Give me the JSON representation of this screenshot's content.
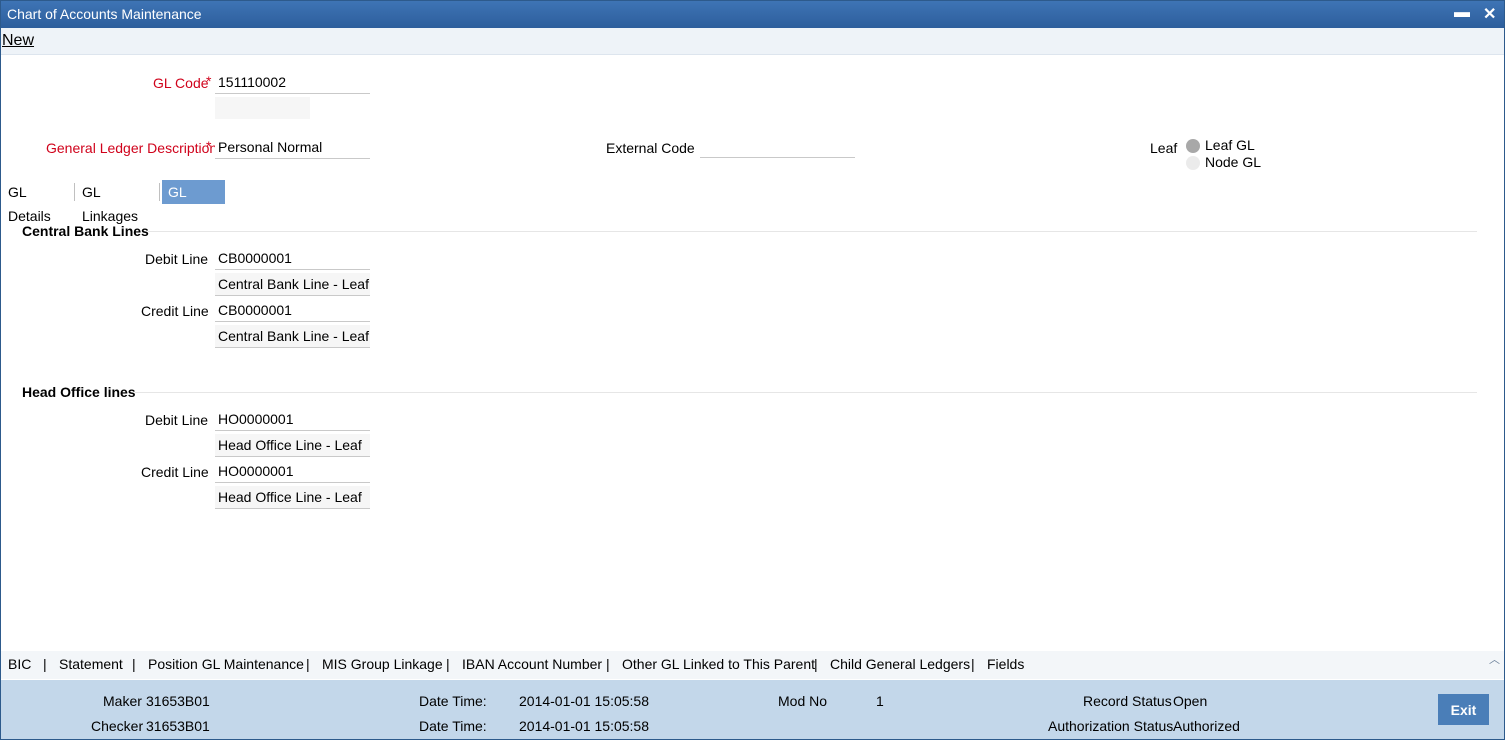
{
  "window": {
    "title": "Chart of Accounts Maintenance",
    "minimize_glyph": "▬",
    "close_glyph": "✕"
  },
  "menu": {
    "new_label": "New"
  },
  "header": {
    "gl_code_label": "GL Code",
    "gl_code_value": "151110002",
    "required_mark": "*",
    "gl_desc_label": "General Ledger Description",
    "gl_desc_value": "Personal Normal",
    "external_code_label": "External Code",
    "external_code_value": "",
    "leaf_label": "Leaf",
    "leaf_options": [
      "Leaf GL",
      "Node GL"
    ],
    "leaf_selected": "Leaf GL"
  },
  "tabs": [
    {
      "label": "GL Details",
      "active": false
    },
    {
      "label": "GL Linkages",
      "active": false
    },
    {
      "label": "GL Lines",
      "active": true
    }
  ],
  "central_bank": {
    "title": "Central Bank Lines",
    "debit_label": "Debit Line",
    "debit_value": "CB0000001",
    "debit_desc": "Central Bank Line - Leaf",
    "credit_label": "Credit Line",
    "credit_value": "CB0000001",
    "credit_desc": "Central Bank Line - Leaf"
  },
  "head_office": {
    "title": "Head Office lines",
    "debit_label": "Debit Line",
    "debit_value": "HO0000001",
    "debit_desc": "Head Office Line - Leaf",
    "credit_label": "Credit Line",
    "credit_value": "HO0000001",
    "credit_desc": "Head Office Line - Leaf"
  },
  "footer_links": [
    "BIC",
    "Statement",
    "Position GL Maintenance",
    "MIS Group Linkage",
    "IBAN Account Number",
    "Other GL Linked to This Parent",
    "Child General Ledgers",
    "Fields"
  ],
  "footer_separator": "|",
  "status": {
    "maker_label": "Maker",
    "maker_value": "31653B01",
    "checker_label": "Checker",
    "checker_value": "31653B01",
    "dt_label": "Date Time:",
    "maker_dt": "2014-01-01 15:05:58",
    "checker_dt": "2014-01-01 15:05:58",
    "modno_label": "Mod No",
    "modno_value": "1",
    "record_status_label": "Record Status",
    "record_status_value": "Open",
    "auth_status_label": "Authorization Status",
    "auth_status_value": "Authorized",
    "exit_label": "Exit"
  },
  "colors": {
    "titlebar": "#3e74b5",
    "active_tab": "#6d9bd0",
    "required": "#d0021b",
    "statusbar": "#c3d7ea",
    "exit_button": "#4a7eb8"
  }
}
